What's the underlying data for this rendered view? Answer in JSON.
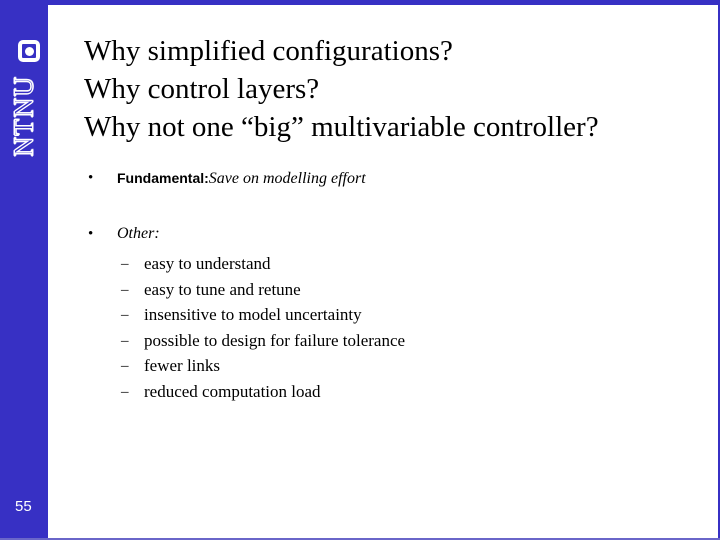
{
  "slide": {
    "page_number": "55",
    "accent_color": "#3730c4",
    "background_color": "#ffffff",
    "text_color": "#000000"
  },
  "logo": {
    "wordmark": "NTNU",
    "mark_icon": "rounded-square-with-dot-icon"
  },
  "title": {
    "line1": "Why simplified configurations?",
    "line2": "Why control layers?",
    "line3": "Why not one “big” multivariable controller?"
  },
  "bullets": [
    {
      "marker": "•",
      "label": "Fundamental:",
      "emphasis": "Save on modelling effort"
    },
    {
      "marker": "•",
      "label": "Other:",
      "emphasis": ""
    }
  ],
  "sub_bullets": {
    "marker": "–",
    "items": [
      "easy to understand",
      "easy to tune and retune",
      "insensitive to model uncertainty",
      "possible to design for failure tolerance",
      "fewer links",
      "reduced computation load"
    ]
  }
}
